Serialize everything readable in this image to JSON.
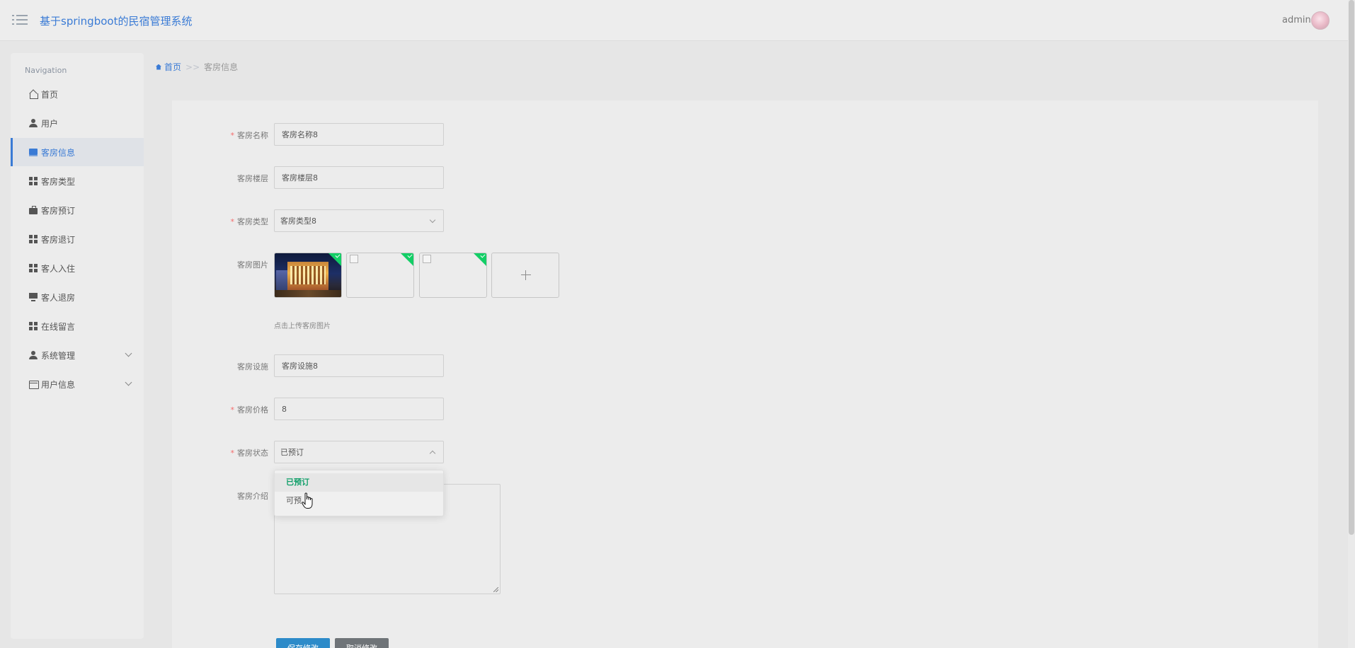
{
  "header": {
    "title": "基于springboot的民宿管理系统",
    "user": "admin"
  },
  "sidebar": {
    "heading": "Navigation",
    "items": [
      {
        "label": "首页",
        "icon": "home-icon"
      },
      {
        "label": "用户",
        "icon": "user-icon"
      },
      {
        "label": "客房信息",
        "icon": "book-icon",
        "active": true
      },
      {
        "label": "客房类型",
        "icon": "grid-icon"
      },
      {
        "label": "客房预订",
        "icon": "briefcase-icon"
      },
      {
        "label": "客房退订",
        "icon": "grid-icon"
      },
      {
        "label": "客人入住",
        "icon": "grid-icon"
      },
      {
        "label": "客人退房",
        "icon": "monitor-icon"
      },
      {
        "label": "在线留言",
        "icon": "grid-icon"
      },
      {
        "label": "系统管理",
        "icon": "user-icon",
        "expandable": true
      },
      {
        "label": "用户信息",
        "icon": "card-icon",
        "expandable": true
      }
    ]
  },
  "breadcrumb": {
    "home": "首页",
    "separator": ">>",
    "current": "客房信息"
  },
  "form": {
    "room_name": {
      "label": "客房名称",
      "value": "客房名称8",
      "required": true
    },
    "floor": {
      "label": "客房楼层",
      "value": "客房楼层8",
      "required": false
    },
    "room_type": {
      "label": "客房类型",
      "value": "客房类型8",
      "required": true
    },
    "images": {
      "label": "客房图片",
      "tip": "点击上传客房图片",
      "count": 3
    },
    "facilities": {
      "label": "客房设施",
      "value": "客房设施8",
      "required": false
    },
    "price": {
      "label": "客房价格",
      "value": "8",
      "required": true
    },
    "status": {
      "label": "客房状态",
      "value": "已预订",
      "required": true,
      "options": [
        "已预订",
        "可预订"
      ],
      "dropdown_visible_options": [
        "已预订",
        "可预"
      ]
    },
    "intro": {
      "label": "客房介绍",
      "value": ""
    }
  },
  "buttons": {
    "save": "保存修改",
    "cancel": "取消修改"
  },
  "colors": {
    "accent": "#3a7bd5",
    "required": "#f56c6c",
    "success": "#13ce66",
    "save_button": "#2d8bc9",
    "cancel_button": "#6f7478"
  }
}
